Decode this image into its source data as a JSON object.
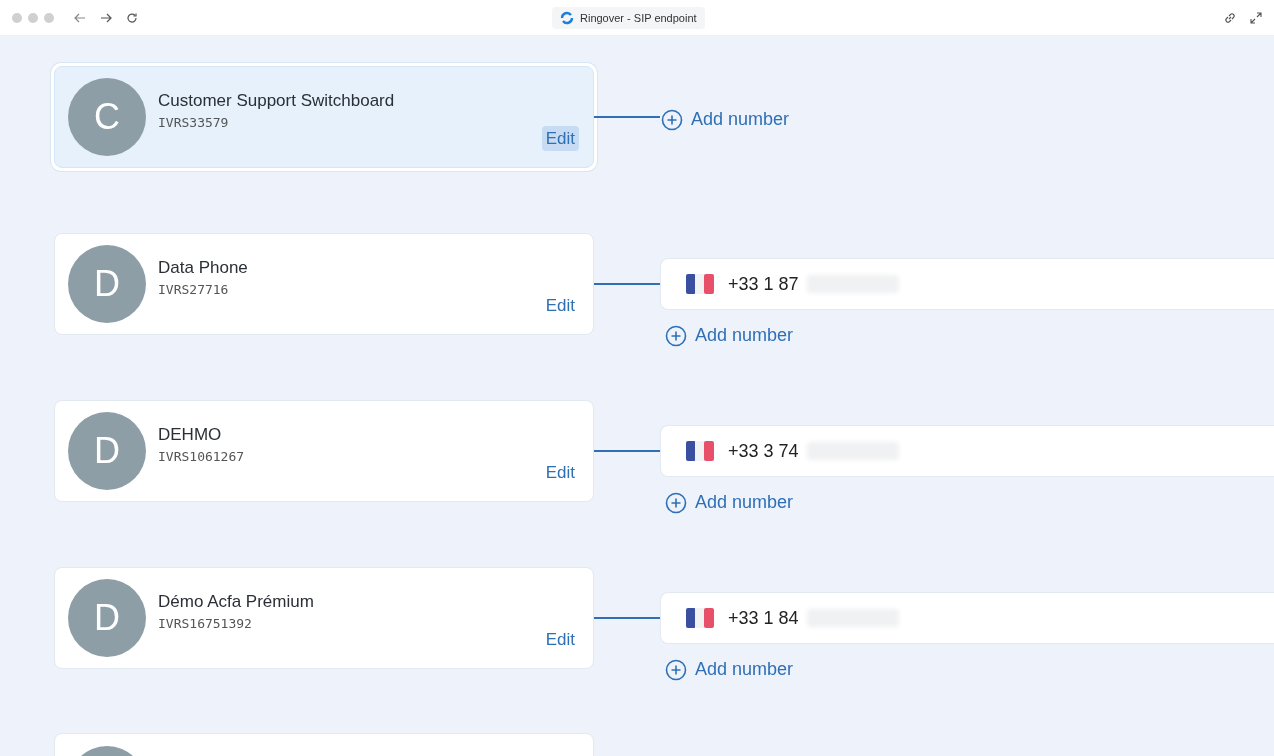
{
  "window": {
    "title": "Ringover - SIP endpoint"
  },
  "endpoints": [
    {
      "initial": "C",
      "name": "Customer Support Switchboard",
      "code": "IVRS33579",
      "edit": "Edit",
      "selected": true,
      "add": "Add number"
    },
    {
      "initial": "D",
      "name": "Data Phone",
      "code": "IVRS27716",
      "edit": "Edit",
      "selected": false,
      "numbers": [
        {
          "number": "+33 1 87"
        }
      ],
      "add": "Add number"
    },
    {
      "initial": "D",
      "name": "DEHMO",
      "code": "IVRS1061267",
      "edit": "Edit",
      "selected": false,
      "numbers": [
        {
          "number": "+33 3 74"
        }
      ],
      "add": "Add number"
    },
    {
      "initial": "D",
      "name": "Démo Acfa Prémium",
      "code": "IVRS16751392",
      "edit": "Edit",
      "selected": false,
      "numbers": [
        {
          "number": "+33 1 84"
        }
      ],
      "add": "Add number"
    }
  ],
  "more_below": true
}
